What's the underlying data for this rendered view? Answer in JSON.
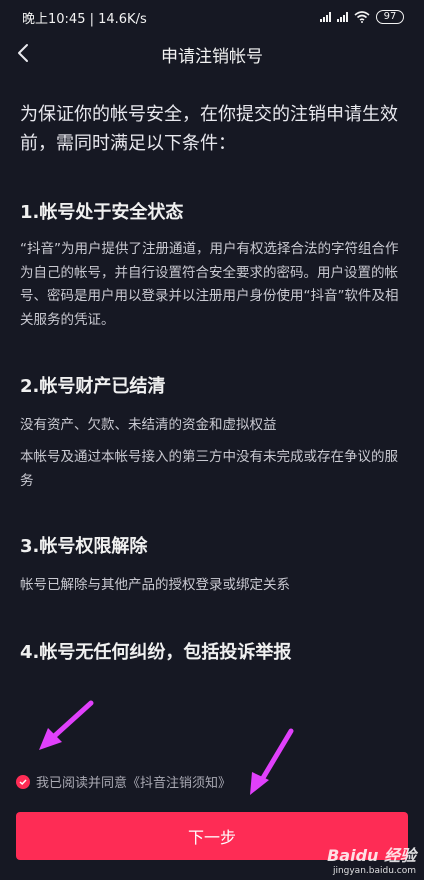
{
  "status_bar": {
    "time_speed": "晚上10:45 | 14.6K/s",
    "battery": "97"
  },
  "nav": {
    "title": "申请注销帐号"
  },
  "intro": "为保证你的帐号安全，在你提交的注销申请生效前，需同时满足以下条件：",
  "sections": [
    {
      "title": "1.帐号处于安全状态",
      "paragraphs": [
        "“抖音”为用户提供了注册通道，用户有权选择合法的字符组合作为自己的帐号，并自行设置符合安全要求的密码。用户设置的帐号、密码是用户用以登录并以注册用户身份使用“抖音”软件及相关服务的凭证。"
      ]
    },
    {
      "title": "2.帐号财产已结清",
      "paragraphs": [
        "没有资产、欠款、未结清的资金和虚拟权益",
        "本帐号及通过本帐号接入的第三方中没有未完成或存在争议的服务"
      ]
    },
    {
      "title": "3.帐号权限解除",
      "paragraphs": [
        "帐号已解除与其他产品的授权登录或绑定关系"
      ]
    },
    {
      "title": "4.帐号无任何纠纷，包括投诉举报",
      "paragraphs": []
    }
  ],
  "agreement": {
    "checked": true,
    "text": "我已阅读并同意《抖音注销须知》"
  },
  "next_button": "下一步",
  "annotation_color": "#e040fb",
  "accent_color": "#fe2c55",
  "watermark": {
    "logo": "Baidu 经验",
    "url": "jingyan.baidu.com"
  }
}
